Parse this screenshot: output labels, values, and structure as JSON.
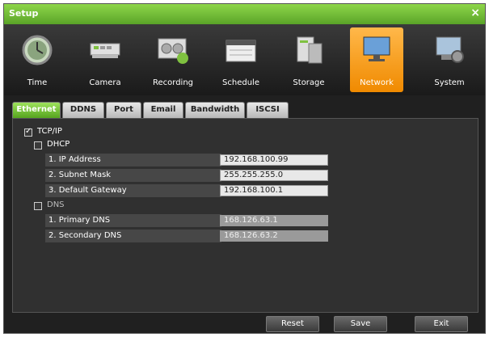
{
  "window": {
    "title": "Setup",
    "close_label": "×"
  },
  "toolbar": [
    {
      "label": "Time",
      "icon": "clock-icon"
    },
    {
      "label": "Camera",
      "icon": "camera-icon"
    },
    {
      "label": "Recording",
      "icon": "recording-icon"
    },
    {
      "label": "Schedule",
      "icon": "schedule-icon"
    },
    {
      "label": "Storage",
      "icon": "storage-icon"
    },
    {
      "label": "Network",
      "icon": "network-icon"
    },
    {
      "label": "System",
      "icon": "system-icon"
    }
  ],
  "tabs": [
    "Ethernet",
    "DDNS",
    "Port",
    "Email",
    "Bandwidth",
    "ISCSI"
  ],
  "panel": {
    "tcpip_label": "TCP/IP",
    "dhcp_label": "DHCP",
    "dns_label": "DNS",
    "rows": [
      {
        "label": "1. IP Address",
        "value": "192.168.100.99"
      },
      {
        "label": "2. Subnet Mask",
        "value": "255.255.255.0"
      },
      {
        "label": "3. Default Gateway",
        "value": "192.168.100.1"
      }
    ],
    "dns_rows": [
      {
        "label": "1. Primary DNS",
        "value": "168.126.63.1"
      },
      {
        "label": "2. Secondary DNS",
        "value": "168.126.63.2"
      }
    ]
  },
  "buttons": {
    "reset": "Reset",
    "save": "Save",
    "exit": "Exit"
  },
  "colors": {
    "accent": "#f08a00",
    "title_green": "#5aa428"
  }
}
